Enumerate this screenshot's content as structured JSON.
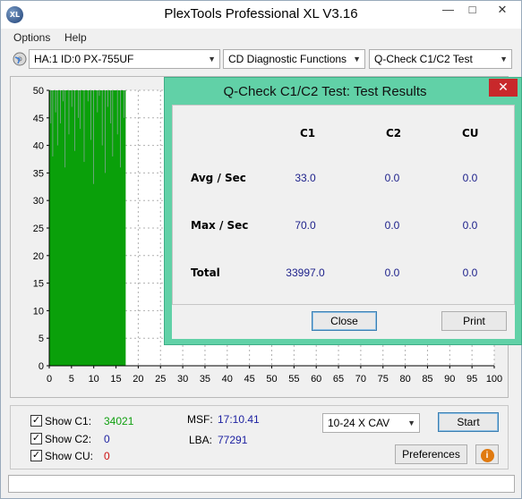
{
  "window": {
    "title": "PlexTools Professional XL V3.16",
    "app_icon_text": "XL",
    "minimize": "—",
    "maximize": "□",
    "close": "✕"
  },
  "menu": [
    "Options",
    "Help"
  ],
  "toolbar": {
    "drive": "HA:1 ID:0  PX-755UF",
    "function": "CD Diagnostic Functions",
    "test": "Q-Check C1/C2 Test"
  },
  "chart_data": {
    "type": "bar",
    "description_series": "C1 errors per second",
    "x_ticks": [
      0,
      5,
      10,
      15,
      20,
      25,
      30,
      35,
      40,
      45,
      50,
      55,
      60,
      65,
      70,
      75,
      80,
      85,
      90,
      95,
      100
    ],
    "y_ticks": [
      0,
      5,
      10,
      15,
      20,
      25,
      30,
      35,
      40,
      45,
      50
    ],
    "xlim": [
      0,
      100
    ],
    "ylim": [
      0,
      50
    ],
    "grid": true,
    "tested_range_end": 17.1,
    "series_color": "#0aa00a",
    "tested_area_color": "#9aa8b0",
    "untested_area_color": "#ffffff",
    "values": [
      50,
      44,
      50,
      38,
      50,
      50,
      46,
      50,
      40,
      50,
      50,
      44,
      50,
      50,
      48,
      50,
      36,
      50,
      50,
      50,
      42,
      50,
      50,
      47,
      50,
      50,
      39,
      50,
      50,
      50,
      45,
      50,
      43,
      50,
      50,
      50,
      37,
      50,
      50,
      50,
      48,
      50,
      50,
      41,
      50,
      50,
      33,
      50,
      50,
      50,
      46,
      50,
      49,
      50,
      50,
      40,
      50,
      50,
      35,
      50,
      50,
      47,
      50,
      50,
      44,
      50,
      38,
      50,
      50,
      50,
      50,
      42,
      50,
      50,
      36,
      50,
      50,
      50,
      45,
      50
    ]
  },
  "dialog": {
    "title": "Q-Check C1/C2 Test: Test Results",
    "close_glyph": "✕",
    "columns": [
      "C1",
      "C2",
      "CU"
    ],
    "rows": [
      {
        "label": "Avg / Sec",
        "c1": "33.0",
        "c2": "0.0",
        "cu": "0.0"
      },
      {
        "label": "Max / Sec",
        "c1": "70.0",
        "c2": "0.0",
        "cu": "0.0"
      },
      {
        "label": "Total",
        "c1": "33997.0",
        "c2": "0.0",
        "cu": "0.0"
      }
    ],
    "close_button": "Close",
    "print_button": "Print"
  },
  "bottom": {
    "show_c1": "Show C1:",
    "show_c2": "Show C2:",
    "show_cu": "Show CU:",
    "c1_count": "34021",
    "c2_count": "0",
    "cu_count": "0",
    "c1_color": "#11a011",
    "c2_color": "#1b1fa0",
    "cu_color": "#cc1111",
    "msf_label": "MSF:",
    "msf_value": "17:10.41",
    "lba_label": "LBA:",
    "lba_value": "77291",
    "speed": "10-24 X CAV",
    "start_button": "Start",
    "preferences_button": "Preferences",
    "info_icon": "i"
  }
}
